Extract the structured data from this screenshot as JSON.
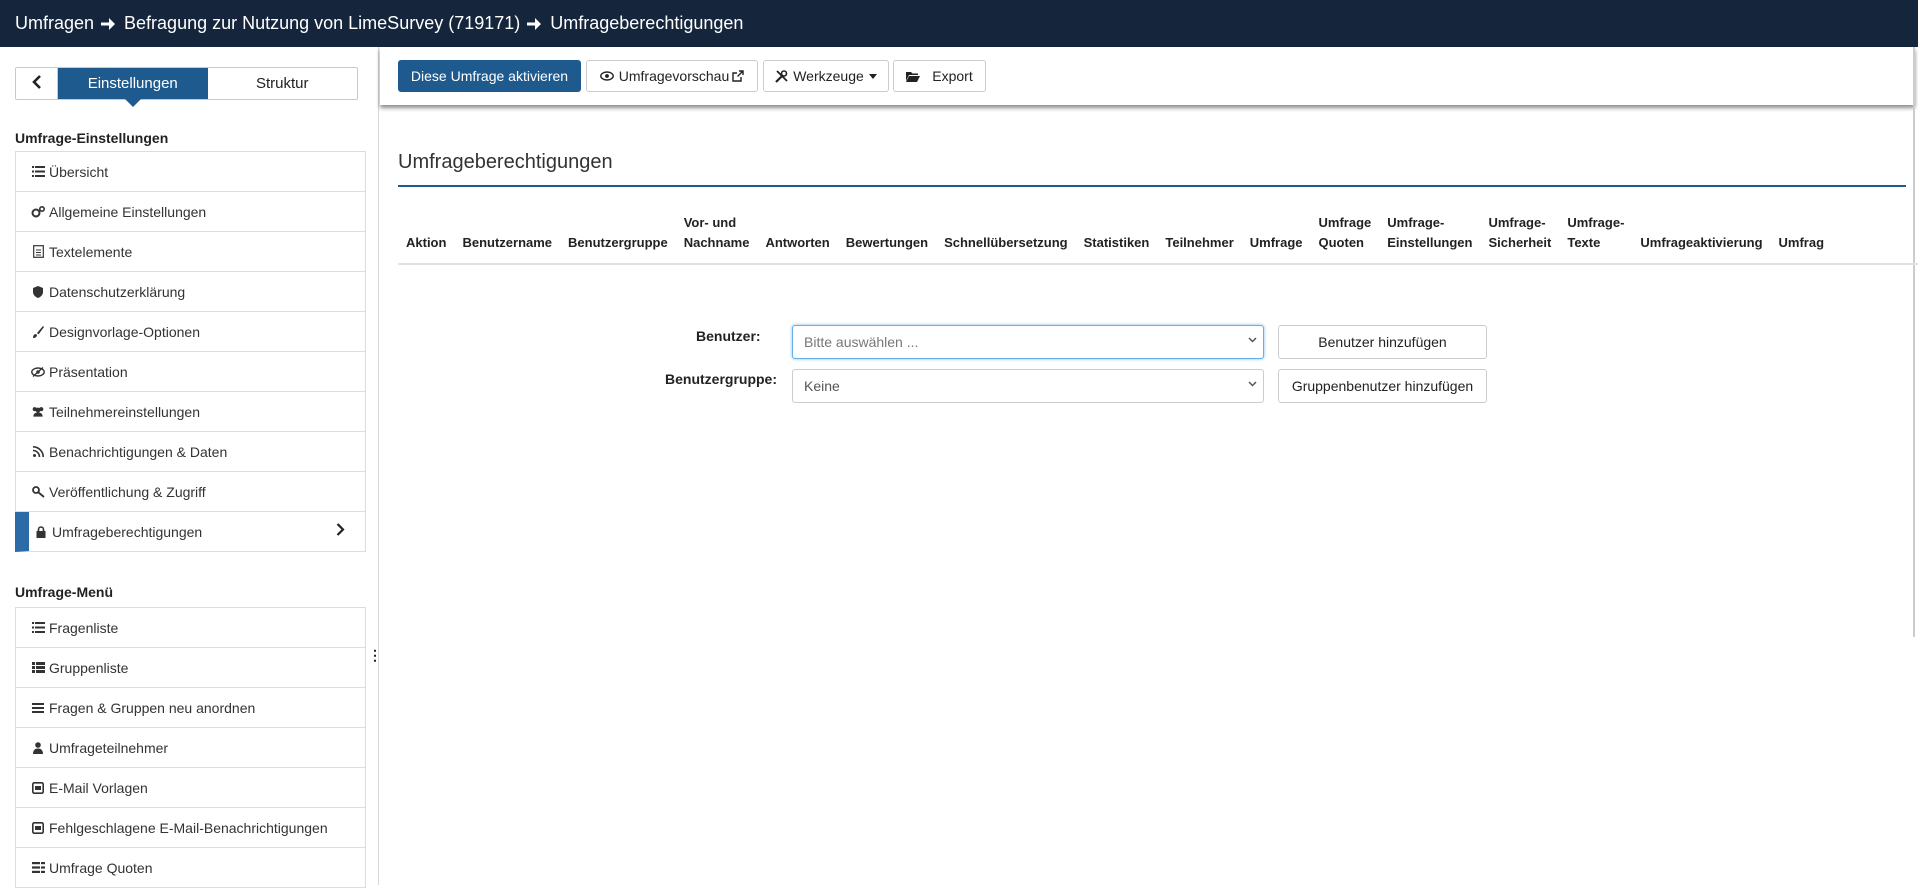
{
  "breadcrumb": {
    "items": [
      "Umfragen",
      "Befragung zur Nutzung von LimeSurvey (719171)",
      "Umfrageberechtigungen"
    ]
  },
  "sidebar": {
    "tabs": {
      "settings": "Einstellungen",
      "structure": "Struktur"
    },
    "settings_title": "Umfrage-Einstellungen",
    "settings_items": [
      {
        "label": "Übersicht",
        "icon": "list-icon"
      },
      {
        "label": "Allgemeine Einstellungen",
        "icon": "cogs-icon"
      },
      {
        "label": "Textelemente",
        "icon": "file-text-icon"
      },
      {
        "label": "Datenschutzerklärung",
        "icon": "shield-icon"
      },
      {
        "label": "Designvorlage-Optionen",
        "icon": "paint-brush-icon"
      },
      {
        "label": "Präsentation",
        "icon": "eye-slash-icon"
      },
      {
        "label": "Teilnehmereinstellungen",
        "icon": "users-icon"
      },
      {
        "label": "Benachrichtigungen & Daten",
        "icon": "rss-icon"
      },
      {
        "label": "Veröffentlichung & Zugriff",
        "icon": "key-icon"
      },
      {
        "label": "Umfrageberechtigungen",
        "icon": "lock-icon"
      }
    ],
    "menu_title": "Umfrage-Menü",
    "menu_items": [
      {
        "label": "Fragenliste",
        "icon": "list-icon"
      },
      {
        "label": "Gruppenliste",
        "icon": "th-list-icon"
      },
      {
        "label": "Fragen & Gruppen neu anordnen",
        "icon": "bars-icon"
      },
      {
        "label": "Umfrageteilnehmer",
        "icon": "user-icon"
      },
      {
        "label": "E-Mail Vorlagen",
        "icon": "envelope-square-icon"
      },
      {
        "label": "Fehlgeschlagene E-Mail-Benachrichtigungen",
        "icon": "envelope-square-icon"
      },
      {
        "label": "Umfrage Quoten",
        "icon": "tasks-icon"
      }
    ]
  },
  "toolbar": {
    "activate": "Diese Umfrage aktivieren",
    "preview": "Umfragevorschau",
    "tools": "Werkzeuge",
    "export": "Export"
  },
  "main": {
    "title": "Umfrageberechtigungen",
    "columns": [
      [
        "",
        "Aktion"
      ],
      [
        "",
        "Benutzername"
      ],
      [
        "",
        "Benutzergruppe"
      ],
      [
        "Vor- und",
        "Nachname"
      ],
      [
        "",
        "Antworten"
      ],
      [
        "",
        "Bewertungen"
      ],
      [
        "",
        "Schnellübersetzung"
      ],
      [
        "",
        "Statistiken"
      ],
      [
        "",
        "Teilnehmer"
      ],
      [
        "",
        "Umfrage"
      ],
      [
        "Umfrage",
        "Quoten"
      ],
      [
        "Umfrage-",
        "Einstellungen"
      ],
      [
        "Umfrage-",
        "Sicherheit"
      ],
      [
        "Umfrage-",
        "Texte"
      ],
      [
        "",
        "Umfrageaktivierung"
      ],
      [
        "",
        "Umfrag"
      ]
    ],
    "user_label": "Benutzer:",
    "user_select": "Bitte auswählen ...",
    "add_user": "Benutzer hinzufügen",
    "group_label": "Benutzergruppe:",
    "group_select": "Keine",
    "add_group": "Gruppenbenutzer hinzufügen"
  }
}
